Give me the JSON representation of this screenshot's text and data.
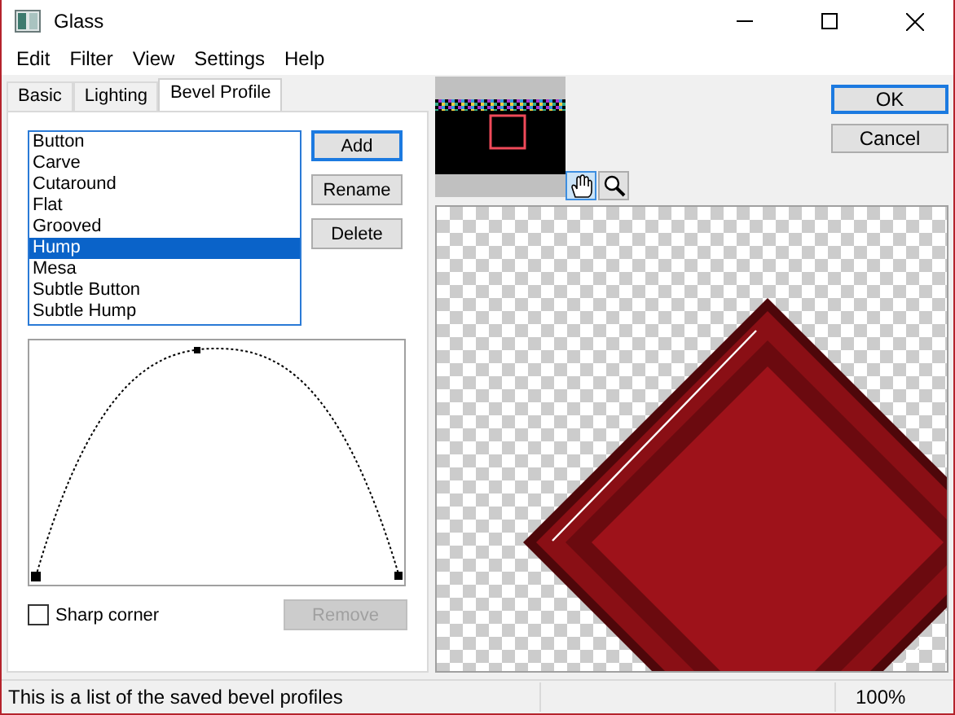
{
  "window": {
    "title": "Glass"
  },
  "menu": [
    "Edit",
    "Filter",
    "View",
    "Settings",
    "Help"
  ],
  "tabs": [
    {
      "label": "Basic",
      "selected": false
    },
    {
      "label": "Lighting",
      "selected": false
    },
    {
      "label": "Bevel Profile",
      "selected": true
    }
  ],
  "profiles": [
    {
      "label": "Button",
      "selected": false
    },
    {
      "label": "Carve",
      "selected": false
    },
    {
      "label": "Cutaround",
      "selected": false
    },
    {
      "label": "Flat",
      "selected": false
    },
    {
      "label": "Grooved",
      "selected": false
    },
    {
      "label": "Hump",
      "selected": true
    },
    {
      "label": "Mesa",
      "selected": false
    },
    {
      "label": "Subtle Button",
      "selected": false
    },
    {
      "label": "Subtle Hump",
      "selected": false
    }
  ],
  "profile_buttons": [
    {
      "label": "Add",
      "disabled": false
    },
    {
      "label": "Rename",
      "disabled": false
    },
    {
      "label": "Delete",
      "disabled": false
    }
  ],
  "sharp_corner": {
    "label": "Sharp corner",
    "checked": false
  },
  "remove_button": {
    "label": "Remove",
    "disabled": true
  },
  "tools": [
    {
      "kind": "hand",
      "selected": true
    },
    {
      "kind": "zoom",
      "selected": false
    }
  ],
  "dialog_buttons": [
    {
      "label": "OK",
      "default": true
    },
    {
      "label": "Cancel",
      "default": false
    }
  ],
  "status_bar": {
    "text": "This is a list of the saved bevel profiles",
    "zoom": "100%"
  }
}
